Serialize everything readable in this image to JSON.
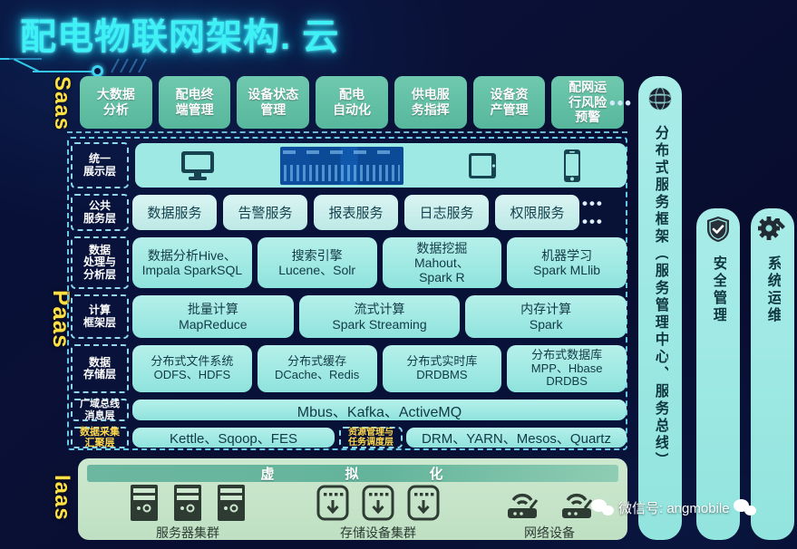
{
  "title": "配电物联网架构. 云",
  "tiers": {
    "saas": "Saas",
    "paas": "Paas",
    "iaas": "Iaas"
  },
  "saas": {
    "cards": [
      "大数据\n分析",
      "配电终\n端管理",
      "设备状态\n管理",
      "配电\n自动化",
      "供电服\n务指挥",
      "设备资\n产管理",
      "配网运\n行风险\n预警"
    ],
    "more": "•••"
  },
  "paas": {
    "display_layer": {
      "label": "统一\n展示层",
      "icons": [
        "monitor-icon",
        "dashboard-image",
        "tablet-icon",
        "phone-icon"
      ]
    },
    "public_service_layer": {
      "label": "公共\n服务层",
      "items": [
        "数据服务",
        "告警服务",
        "报表服务",
        "日志服务",
        "权限服务"
      ],
      "more": "•••  •••"
    },
    "processing_layer": {
      "label": "数据\n处理与\n分析层",
      "items": [
        "数据分析Hive、\nImpala SparkSQL",
        "搜索引擎\nLucene、Solr",
        "数据挖掘\nMahout、\nSpark R",
        "机器学习\nSpark MLlib"
      ]
    },
    "compute_layer": {
      "label": "计算\n框架层",
      "items": [
        "批量计算\nMapReduce",
        "流式计算\nSpark Streaming",
        "内存计算\nSpark"
      ]
    },
    "storage_layer": {
      "label": "数据\n存储层",
      "items": [
        "分布式文件系统\nODFS、HDFS",
        "分布式缓存\nDCache、Redis",
        "分布式实时库\nDRDBMS",
        "分布式数据库\nMPP、Hbase\nDRDBS"
      ]
    },
    "bus_layer": {
      "label": "广域总线\n消息层",
      "value": "Mbus、Kafka、ActiveMQ"
    },
    "collect_layer": {
      "label": "数据采集\n汇聚层",
      "value": "Kettle、Sqoop、FES"
    },
    "schedule_layer": {
      "label": "资源管理与\n任务调度层",
      "value": "DRM、YARN、Mesos、Quartz"
    }
  },
  "iaas": {
    "virtualization": [
      "虚",
      "拟",
      "化"
    ],
    "groups": [
      {
        "caption": "服务器集群",
        "icon": "server-icon",
        "count": 3
      },
      {
        "caption": "存储设备集群",
        "icon": "storage-icon",
        "count": 3
      },
      {
        "caption": "网络设备",
        "icon": "router-icon",
        "count": 2
      }
    ]
  },
  "side_panels": [
    {
      "icon": "network-globe-icon",
      "text": "分布式服务框架（服务管理中心、服务总线）"
    },
    {
      "icon": "shield-check-icon",
      "text": "安全管理"
    },
    {
      "icon": "gear-icon",
      "text": "系统运维"
    }
  ],
  "watermark": {
    "text": "微信号: angmobile"
  },
  "colors": {
    "background": "#060a2c",
    "title": "#3ff1f5",
    "tier_label": "#ffe043",
    "saas_card": "#57b79c",
    "paas_cell": "#8fe3dd",
    "iaas_panel": "#cde8cf",
    "side_panel": "#92e4de",
    "gold_label": "#ffd84a"
  }
}
